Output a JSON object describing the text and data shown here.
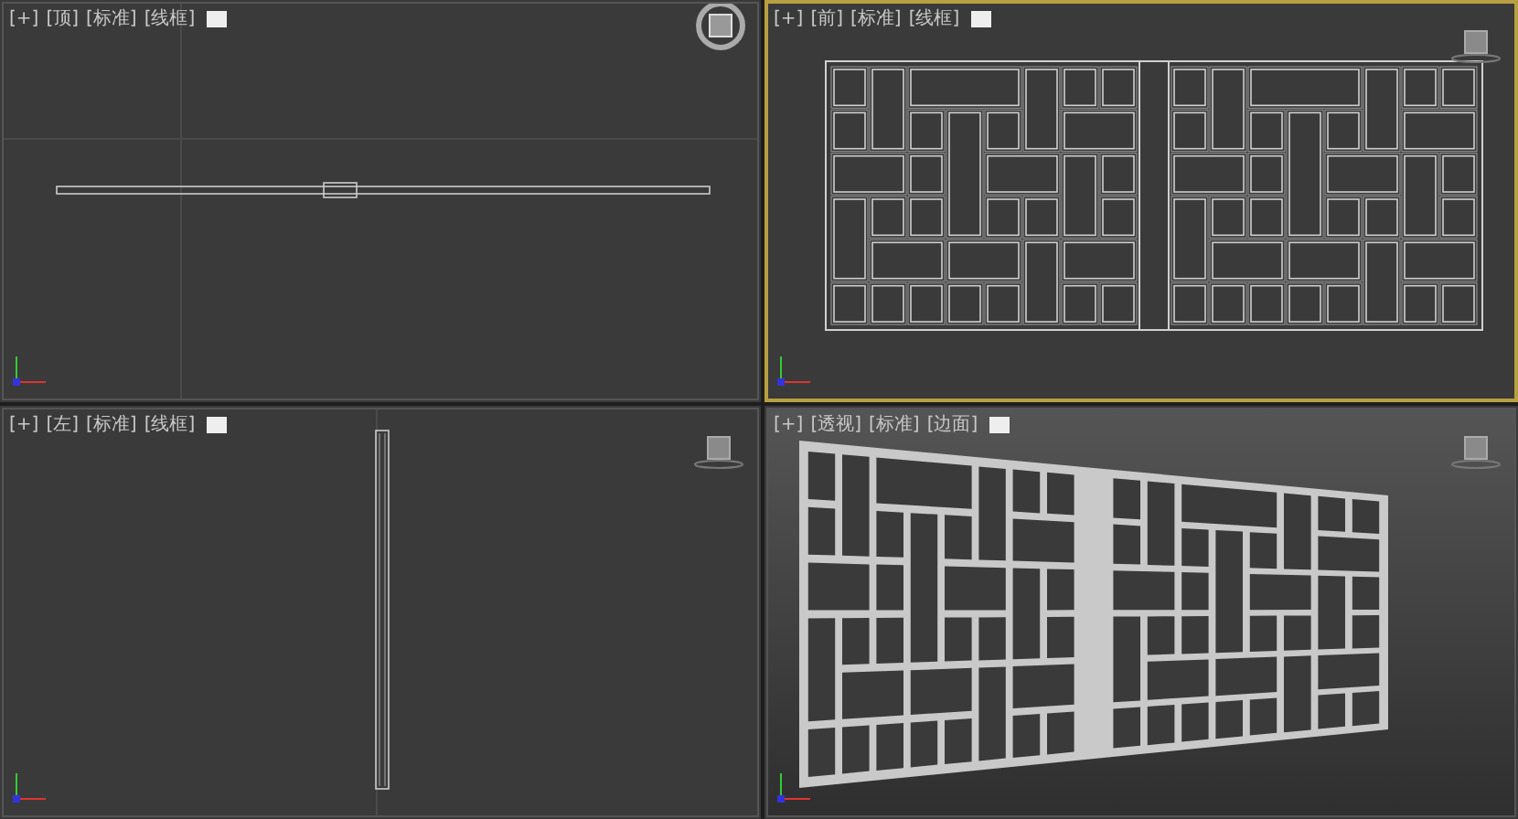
{
  "viewports": [
    {
      "kind": "top",
      "selected": false,
      "labels": [
        "[+]",
        "[顶]",
        "[标准]",
        "[线框]"
      ]
    },
    {
      "kind": "front",
      "selected": true,
      "labels": [
        "[+]",
        "[前]",
        "[标准]",
        "[线框]"
      ]
    },
    {
      "kind": "left",
      "selected": false,
      "labels": [
        "[+]",
        "[左]",
        "[标准]",
        "[线框]"
      ]
    },
    {
      "kind": "perspective",
      "selected": false,
      "labels": [
        "[+]",
        "[透视]",
        "[标准]",
        "[边面]"
      ]
    }
  ]
}
